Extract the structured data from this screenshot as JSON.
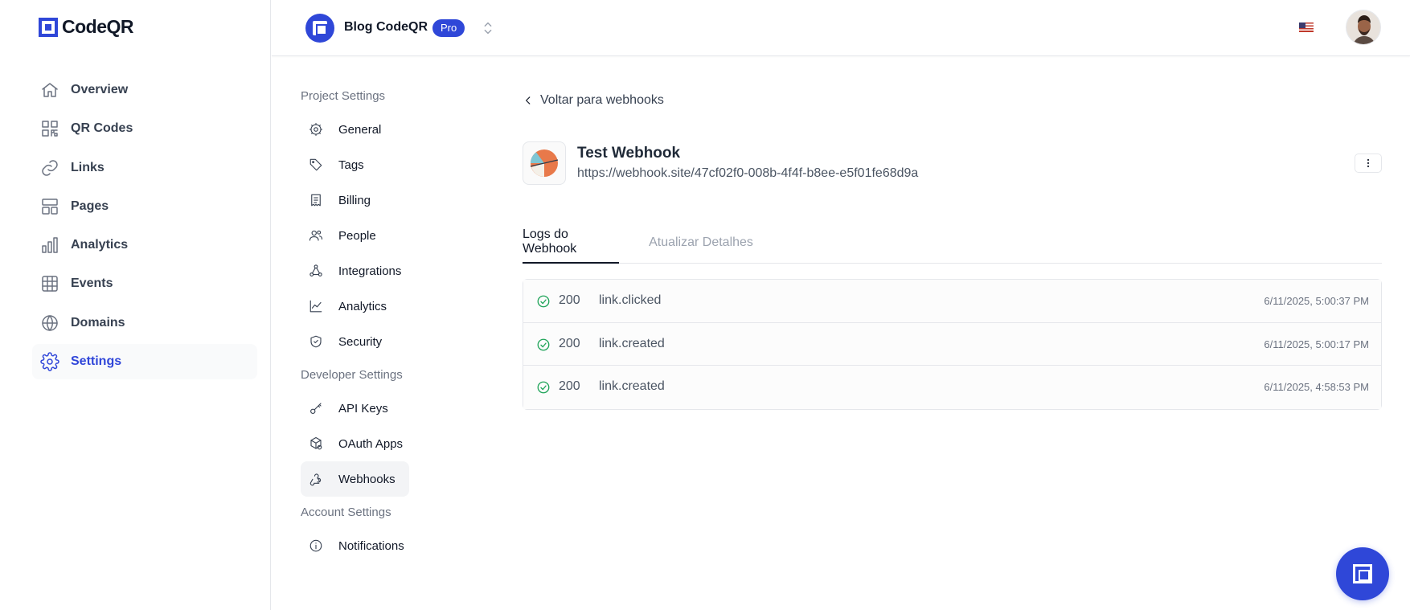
{
  "brand": {
    "name": "CodeQR"
  },
  "sidebar": {
    "items": [
      {
        "label": "Overview",
        "icon": "home-icon"
      },
      {
        "label": "QR Codes",
        "icon": "qr-code-icon"
      },
      {
        "label": "Links",
        "icon": "link-icon"
      },
      {
        "label": "Pages",
        "icon": "layout-icon"
      },
      {
        "label": "Analytics",
        "icon": "bar-chart-icon"
      },
      {
        "label": "Events",
        "icon": "table-icon"
      },
      {
        "label": "Domains",
        "icon": "globe-icon"
      },
      {
        "label": "Settings",
        "icon": "gear-icon",
        "active": true
      }
    ]
  },
  "topbar": {
    "project_name": "Blog CodeQR",
    "plan_badge": "Pro"
  },
  "settings_nav": {
    "project_title": "Project Settings",
    "project_items": [
      {
        "label": "General",
        "icon": "gear-icon"
      },
      {
        "label": "Tags",
        "icon": "tag-icon"
      },
      {
        "label": "Billing",
        "icon": "receipt-icon"
      },
      {
        "label": "People",
        "icon": "users-icon"
      },
      {
        "label": "Integrations",
        "icon": "integrations-icon"
      },
      {
        "label": "Analytics",
        "icon": "line-chart-icon"
      },
      {
        "label": "Security",
        "icon": "shield-icon"
      }
    ],
    "developer_title": "Developer Settings",
    "developer_items": [
      {
        "label": "API Keys",
        "icon": "key-icon"
      },
      {
        "label": "OAuth Apps",
        "icon": "cube-icon"
      },
      {
        "label": "Webhooks",
        "icon": "webhook-icon",
        "active": true
      }
    ],
    "account_title": "Account Settings",
    "account_items": [
      {
        "label": "Notifications",
        "icon": "info-icon"
      }
    ]
  },
  "main": {
    "back_label": "Voltar para webhooks",
    "webhook": {
      "name": "Test Webhook",
      "url": "https://webhook.site/47cf02f0-008b-4f4f-b8ee-e5f01fe68d9a"
    },
    "tabs": [
      {
        "label": "Logs do Webhook",
        "active": true
      },
      {
        "label": "Atualizar Detalhes",
        "active": false
      }
    ],
    "logs": [
      {
        "status": "200",
        "event": "link.clicked",
        "timestamp": "6/11/2025, 5:00:37 PM"
      },
      {
        "status": "200",
        "event": "link.created",
        "timestamp": "6/11/2025, 5:00:17 PM"
      },
      {
        "status": "200",
        "event": "link.created",
        "timestamp": "6/11/2025, 4:58:53 PM"
      }
    ]
  },
  "colors": {
    "brand": "#2f47d8",
    "active_nav": "#3046d9",
    "success": "#22a55b"
  }
}
